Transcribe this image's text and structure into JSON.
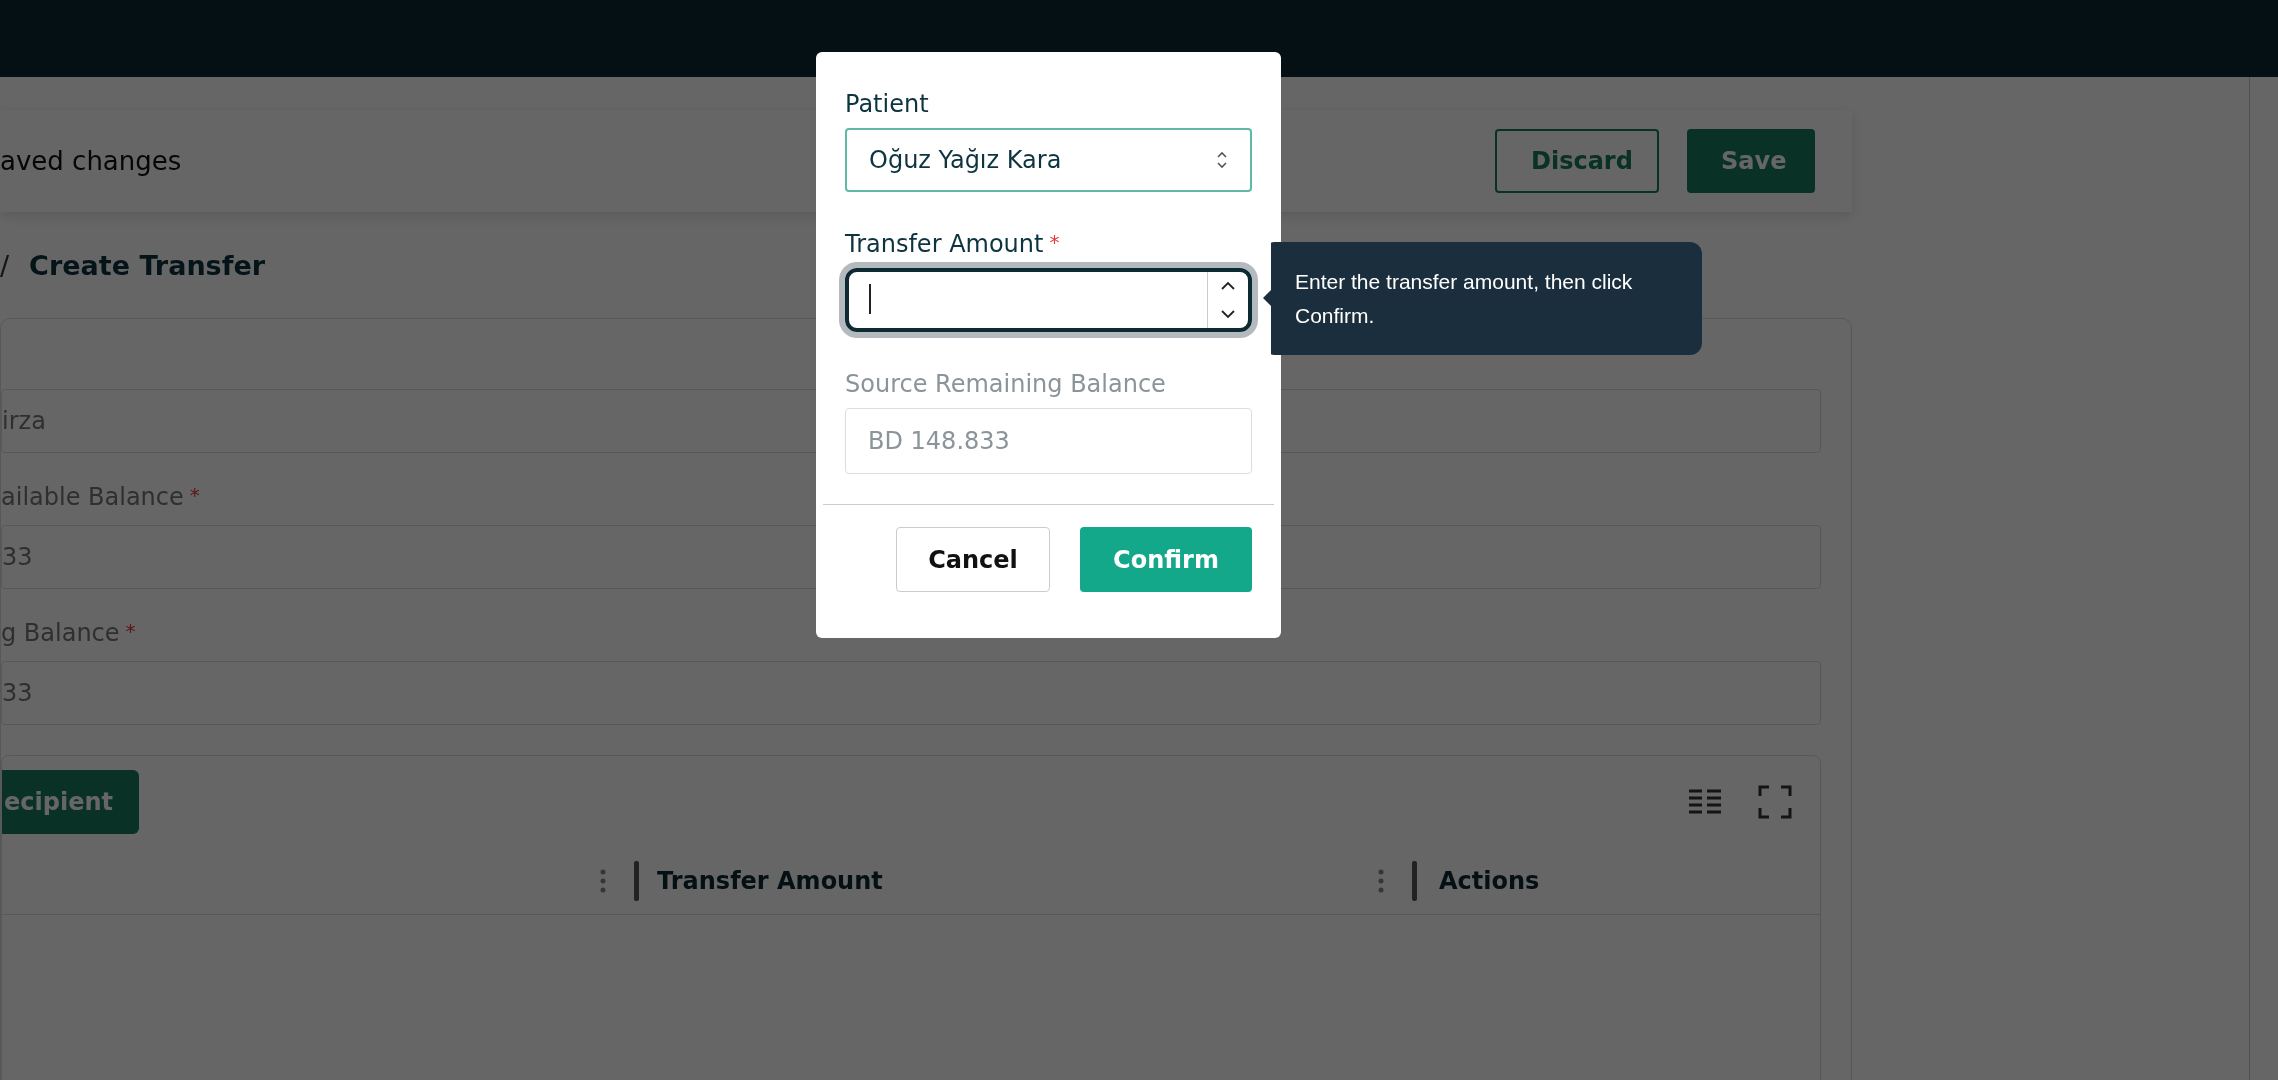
{
  "header": {
    "title": "aved changes",
    "buttons": [
      {
        "label": "Discard",
        "kind": "outline"
      },
      {
        "label": "Save",
        "kind": "primary"
      }
    ]
  },
  "breadcrumb": {
    "separator": "/",
    "current": "Create Transfer"
  },
  "form": {
    "fields": [
      {
        "value": "irza"
      },
      {
        "label": "ailable Balance",
        "required_mark": "*",
        "value": "33"
      },
      {
        "label": "g Balance",
        "required_mark": "*",
        "value": "33"
      }
    ]
  },
  "table": {
    "add_button": "ecipient",
    "columns": [
      {
        "label": "Transfer Amount"
      },
      {
        "label": "Actions"
      }
    ]
  },
  "modal": {
    "patient": {
      "label": "Patient",
      "value": "Oğuz Yağız Kara"
    },
    "amount": {
      "label": "Transfer Amount",
      "required_mark": "*",
      "focused": true
    },
    "balance": {
      "label": "Source Remaining Balance",
      "value": "BD 148.833",
      "disabled": true
    },
    "buttons": [
      {
        "label": "Cancel",
        "kind": "outline"
      },
      {
        "label": "Confirm",
        "kind": "primary"
      }
    ]
  },
  "tooltip": {
    "text": "Enter the transfer amount, then click Confirm."
  }
}
